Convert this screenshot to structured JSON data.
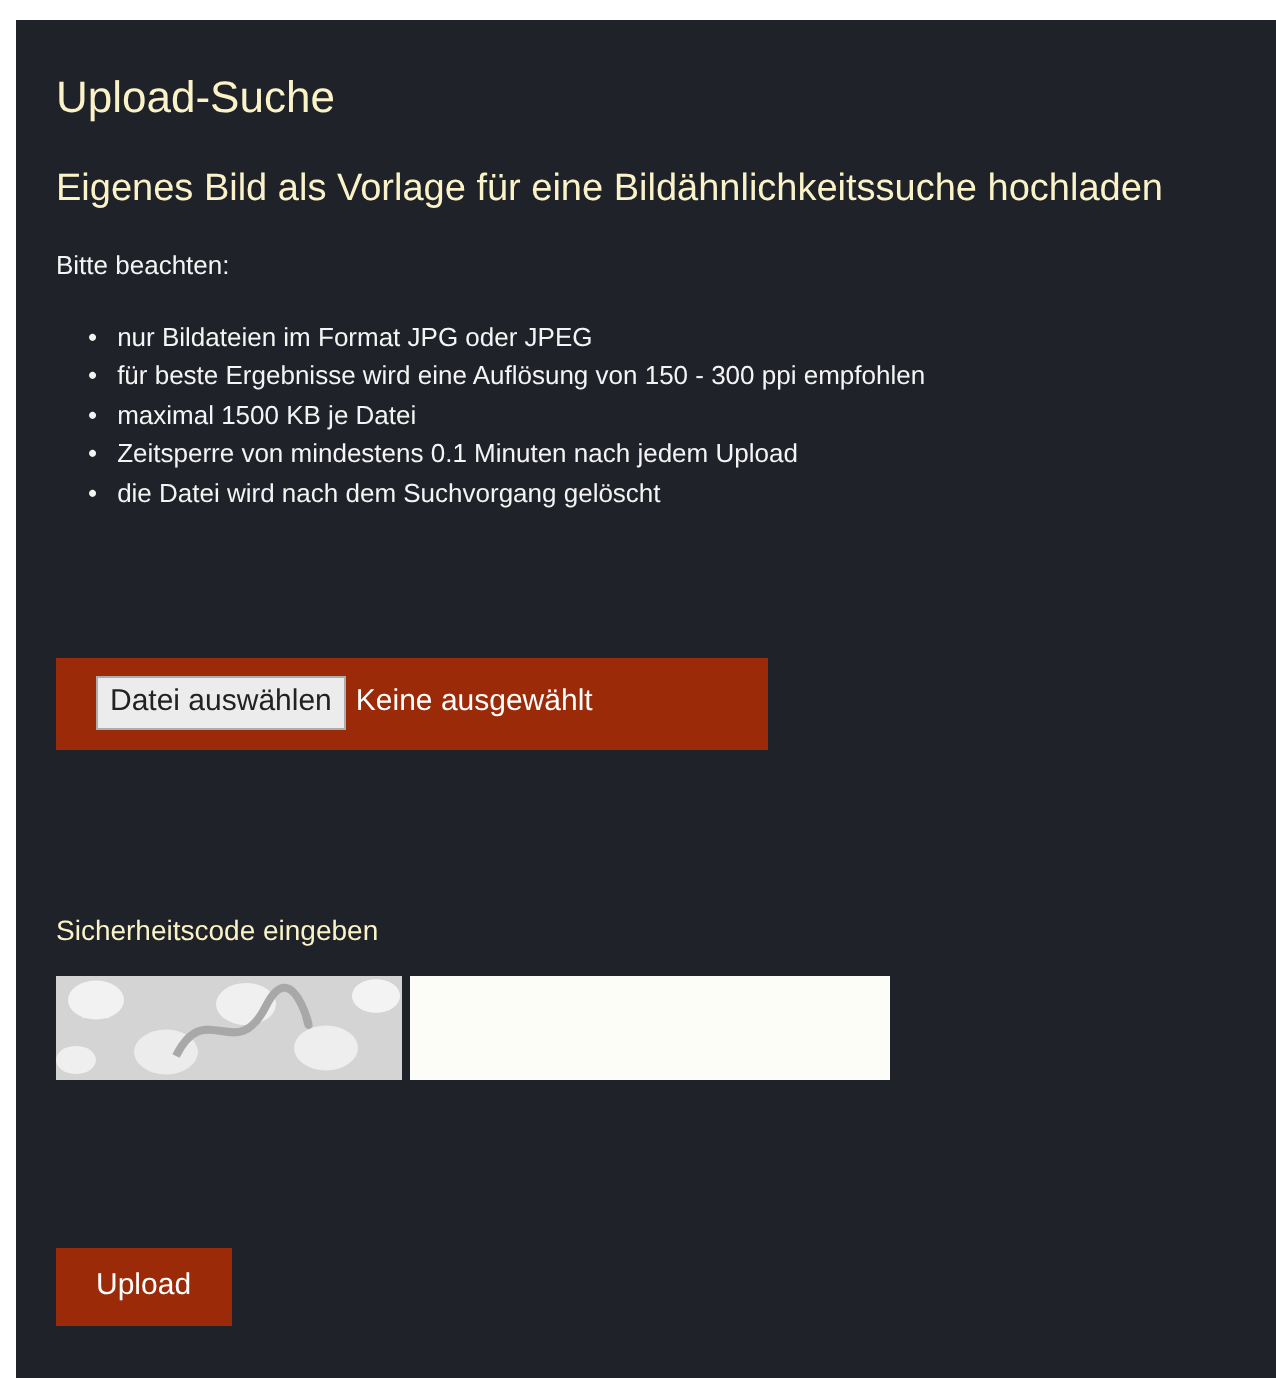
{
  "title": "Upload-Suche",
  "subtitle": "Eigenes Bild als Vorlage für eine Bildähnlichkeitssuche hochladen",
  "note_heading": "Bitte beachten:",
  "notes": [
    {
      "marker": "•",
      "text": "nur Bildateien im Format JPG oder JPEG"
    },
    {
      "marker": "•",
      "text": "für beste Ergebnisse wird eine Auflösung von 150 - 300 ppi empfohlen"
    },
    {
      "marker": "•",
      "text": "maximal 1500 KB je Datei"
    },
    {
      "marker": "•",
      "text": "Zeitsperre von mindestens 0.1 Minuten nach jedem Upload"
    },
    {
      "marker": "•",
      "text": "die Datei wird nach dem Suchvorgang gelöscht"
    }
  ],
  "file_picker": {
    "button": "Datei auswählen",
    "status": "Keine ausgewählt"
  },
  "captcha": {
    "label": "Sicherheitscode eingeben"
  },
  "submit": "Upload"
}
